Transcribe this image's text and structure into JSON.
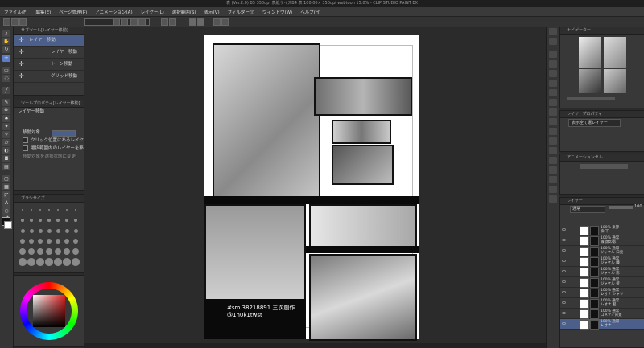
{
  "window": {
    "title": "表 (Ver.2.0) B5 350dpi 表紙サイズB4 表 100.00× 350dpi webtoon 15.0% - CLIP STUDIO PAINT EX"
  },
  "menu": [
    "ファイル(F)",
    "編集(E)",
    "ページ管理(P)",
    "アニメーション(A)",
    "レイヤー(L)",
    "選択範囲(S)",
    "表示(V)",
    "フィルター(I)",
    "ウィンドウ(W)",
    "ヘルプ(H)"
  ],
  "tool_property_panel": {
    "header": "サブツール[レイヤー移動]",
    "subtools": [
      {
        "label": "レイヤー移動",
        "selected": true
      },
      {
        "label": "レイヤー移動",
        "selected": false
      },
      {
        "label": "トーン移動",
        "selected": false
      },
      {
        "label": "グリッド移動",
        "selected": false
      }
    ]
  },
  "property_panel": {
    "header": "ツールプロパティ[レイヤー移動]",
    "title": "レイヤー移動",
    "rows": [
      {
        "label": "移動対象",
        "checkbox": false
      },
      {
        "label": "クリック位置にあるレイヤーを移動",
        "checkbox": true
      },
      {
        "label": "選択範囲内のレイヤーを移動",
        "checkbox": true
      },
      {
        "label": "移動対象を選択状態に変更",
        "checkbox": false
      }
    ]
  },
  "brush_size_panel": {
    "header": "ブラシサイズ"
  },
  "canvas": {
    "caption_line1": "#sm 38218891 三次創作",
    "caption_line2": "@1n0k1twst"
  },
  "navigator": {
    "header": "ナビゲーター"
  },
  "layer_property": {
    "header": "レイヤープロパティ",
    "selector": "表示全て選レイヤー"
  },
  "animation_panel": {
    "header": "アニメーションセル"
  },
  "layers_panel": {
    "header": "レイヤー",
    "blend": "通常",
    "opacity": "100",
    "layers": [
      {
        "info": "100% 乗算",
        "name": "枠 下",
        "selected": false
      },
      {
        "info": "100% 通常",
        "name": "線 顔の影",
        "selected": false
      },
      {
        "info": "100% 通常",
        "name": "ジャケル 口元",
        "selected": false
      },
      {
        "info": "100% 通常",
        "name": "ジャケル 瞳",
        "selected": false
      },
      {
        "info": "100% 通常",
        "name": "ジャケル 影",
        "selected": false
      },
      {
        "info": "100% 通常",
        "name": "ジャケル 髪",
        "selected": false
      },
      {
        "info": "100% 通常",
        "name": "レオナ シャツ",
        "selected": false
      },
      {
        "info": "100% 通常",
        "name": "レオナ 髪",
        "selected": false
      },
      {
        "info": "100% 通常",
        "name": "コメディ背景",
        "selected": false
      },
      {
        "info": "100% 通常",
        "name": "レオナ",
        "selected": true
      }
    ]
  },
  "colors": {
    "accent": "#5b7dc4",
    "selection": "#4b5f8a",
    "panel_bg": "#383838",
    "canvas_bg": "#2b2b2b"
  }
}
